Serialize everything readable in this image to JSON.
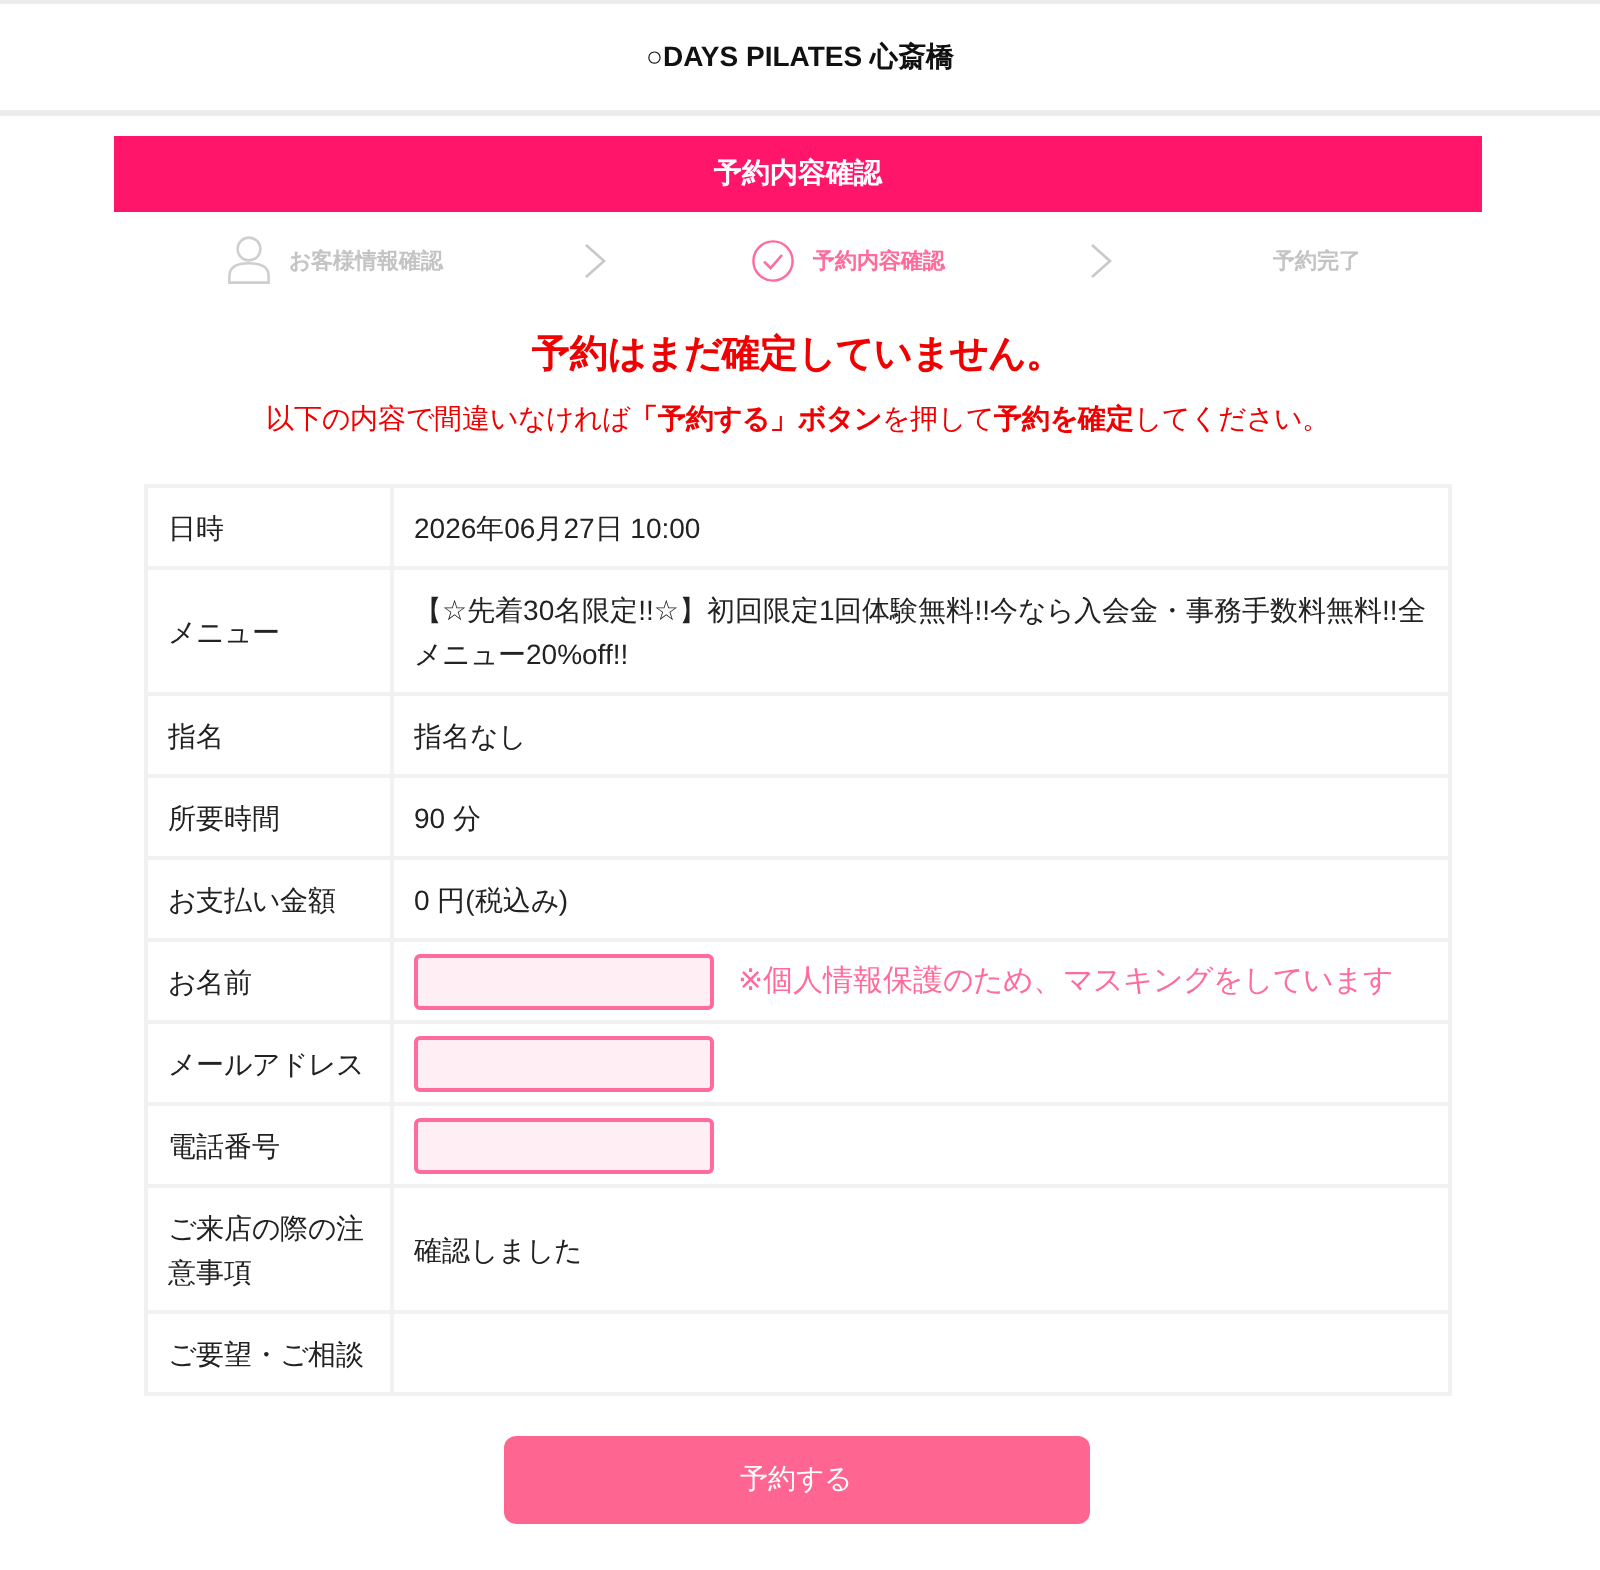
{
  "header": {
    "logo": "○DAYS PILATES 心斎橋"
  },
  "banner": {
    "title": "予約内容確認"
  },
  "steps": [
    {
      "label": "お客様情報確認",
      "kind": "profile",
      "selected": false
    },
    {
      "label": "予約内容確認",
      "kind": "check",
      "selected": true
    },
    {
      "label": "予約完了",
      "kind": "plain",
      "selected": false
    }
  ],
  "notice": {
    "title": "予約はまだ確定していません。",
    "message": "以下の内容で間違いなければ**「予約する」ボタン**を押して**予約を確定**してください。"
  },
  "table": {
    "rows": [
      {
        "kind": "text",
        "label": "日時",
        "value": "2026年06月27日 10:00"
      },
      {
        "kind": "text",
        "label": "メニュー",
        "value": "【☆先着30名限定!!☆】初回限定1回体験無料!!今なら入会金・事務手数料無料!!全メニュー20%off!!"
      },
      {
        "kind": "text",
        "label": "指名",
        "value": "指名なし"
      },
      {
        "kind": "text",
        "label": "所要時間",
        "value": "90 分"
      },
      {
        "kind": "text",
        "label": "お支払い金額",
        "value": "0 円(税込み)"
      },
      {
        "kind": "masked",
        "label": "お名前",
        "note": "※個人情報保護のため、マスキングをしています"
      },
      {
        "kind": "masked",
        "label": "メールアドレス"
      },
      {
        "kind": "masked",
        "label": "電話番号"
      },
      {
        "kind": "text",
        "label": "ご来店の際の注意事項",
        "value": "確認しました"
      },
      {
        "kind": "text",
        "label": "ご要望・ご相談"
      }
    ]
  },
  "submit_button": {
    "label": "予約する"
  }
}
